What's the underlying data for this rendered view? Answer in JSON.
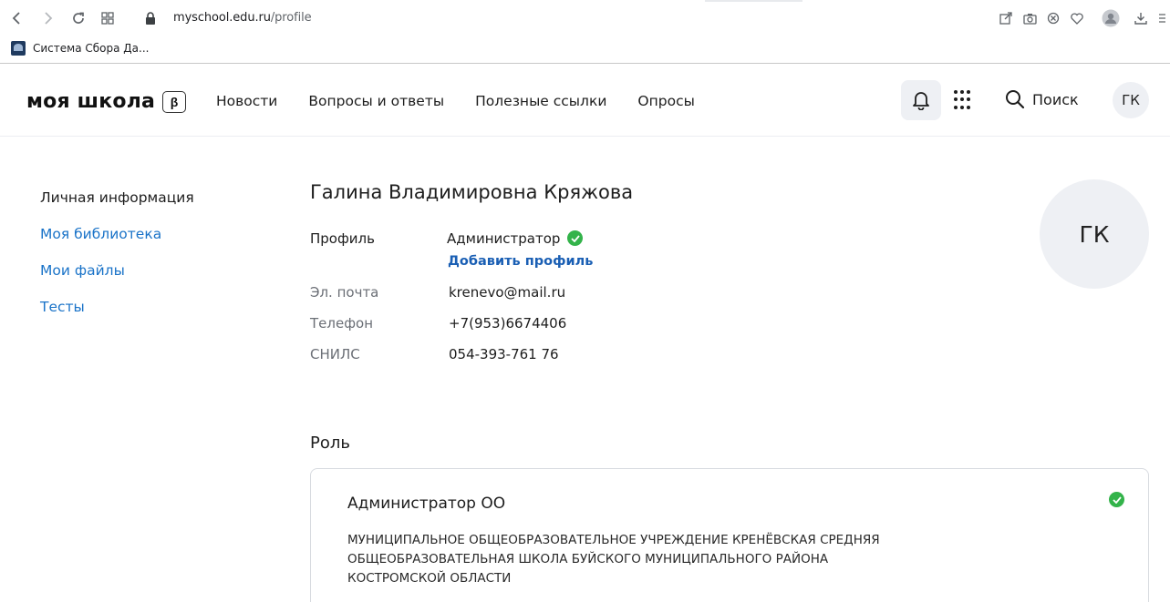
{
  "browser": {
    "url_host": "myschool.edu.ru",
    "url_path": "/profile",
    "bookmark_label": "Система Сбора Да..."
  },
  "header": {
    "logo_text": "моя школа",
    "logo_badge": "β",
    "nav": [
      "Новости",
      "Вопросы и ответы",
      "Полезные ссылки",
      "Опросы"
    ],
    "search_label": "Поиск",
    "avatar_initials": "ГК"
  },
  "sidebar": {
    "items": [
      {
        "label": "Личная информация"
      },
      {
        "label": "Моя библиотека"
      },
      {
        "label": "Мои файлы"
      },
      {
        "label": "Тесты"
      }
    ]
  },
  "profile": {
    "name": "Галина Владимировна Кряжова",
    "profile_label": "Профиль",
    "profile_value": "Администратор",
    "add_profile": "Добавить профиль",
    "email_label": "Эл. почта",
    "email_value": "krenevo@mail.ru",
    "phone_label": "Телефон",
    "phone_value": "+7(953)6674406",
    "snils_label": "СНИЛС",
    "snils_value": "054-393-761 76",
    "avatar_initials": "ГК"
  },
  "role": {
    "section_title": "Роль",
    "card_title": "Администратор ОО",
    "org_name": "МУНИЦИПАЛЬНОЕ ОБЩЕОБРАЗОВАТЕЛЬНОЕ УЧРЕЖДЕНИЕ КРЕНЁВСКАЯ СРЕДНЯЯ ОБЩЕОБРАЗОВАТЕЛЬНАЯ ШКОЛА БУЙСКОГО МУНИЦИПАЛЬНОГО РАЙОНА КОСТРОМСКОЙ ОБЛАСТИ"
  },
  "colors": {
    "link": "#1a73c8",
    "success": "#33b34a",
    "avatar_bg": "#eef0f4"
  }
}
